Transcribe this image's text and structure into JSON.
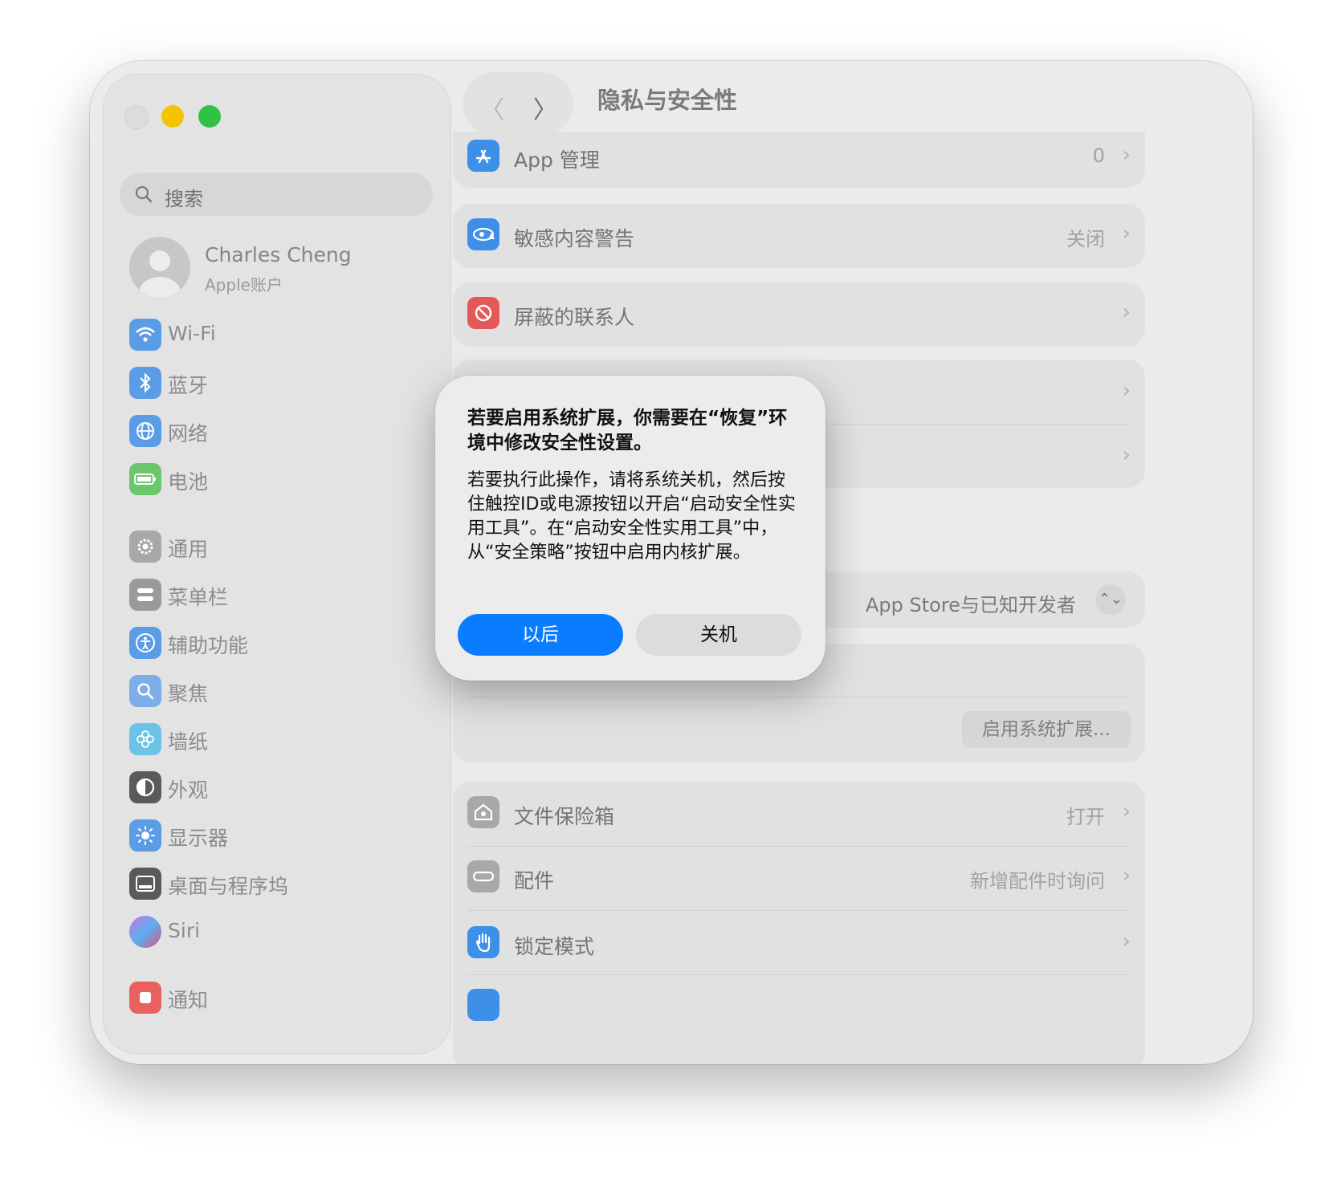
{
  "window": {
    "page_title": "隐私与安全性"
  },
  "sidebar": {
    "search_placeholder": "搜索",
    "profile": {
      "name": "Charles Cheng",
      "subtitle": "Apple账户"
    },
    "items": [
      {
        "label": "Wi-Fi",
        "icon": "wifi-icon",
        "color": "#4a90e2"
      },
      {
        "label": "蓝牙",
        "icon": "bluetooth-icon",
        "color": "#4a90e2"
      },
      {
        "label": "网络",
        "icon": "globe-icon",
        "color": "#4a90e2"
      },
      {
        "label": "电池",
        "icon": "battery-icon",
        "color": "#5ac05a"
      },
      {
        "label": "通用",
        "icon": "gear-icon",
        "color": "#9a9a9a"
      },
      {
        "label": "菜单栏",
        "icon": "menubar-icon",
        "color": "#8a8a8a"
      },
      {
        "label": "辅助功能",
        "icon": "accessibility-icon",
        "color": "#4a90e2"
      },
      {
        "label": "聚焦",
        "icon": "magnifier-icon",
        "color": "#6a9fe2"
      },
      {
        "label": "墙纸",
        "icon": "flower-icon",
        "color": "#5bb7e0"
      },
      {
        "label": "外观",
        "icon": "appearance-icon",
        "color": "#4a4a4a"
      },
      {
        "label": "显示器",
        "icon": "sun-icon",
        "color": "#4a90e2"
      },
      {
        "label": "桌面与程序坞",
        "icon": "dock-icon",
        "color": "#4a4a4a"
      },
      {
        "label": "Siri",
        "icon": "siri-icon",
        "color": "#b565d8"
      },
      {
        "label": "通知",
        "icon": "bell-icon",
        "color": "#e05050"
      }
    ]
  },
  "main": {
    "rows": {
      "app_management": {
        "label": "App 管理",
        "value": "0"
      },
      "sensitive_content": {
        "label": "敏感内容警告",
        "value": "关闭"
      },
      "blocked_contacts": {
        "label": "屏蔽的联系人"
      },
      "allow_apps_value": "App Store与已知开发者",
      "enable_extensions_button": "启用系统扩展...",
      "filevault": {
        "label": "文件保险箱",
        "value": "打开"
      },
      "accessories": {
        "label": "配件",
        "value": "新增配件时询问"
      },
      "lockdown": {
        "label": "锁定模式"
      }
    }
  },
  "dialog": {
    "title": "若要启用系统扩展，你需要在“恢复”环境中修改安全性设置。",
    "body": "若要执行此操作，请将系统关机，然后按住触控ID或电源按钮以开启“启动安全性实用工具”。在“启动安全性实用工具”中，从“安全策略”按钮中启用内核扩展。",
    "later_button": "以后",
    "shutdown_button": "关机"
  },
  "colors": {
    "accent_blue": "#0a7cff",
    "traffic_min": "#f5c400",
    "traffic_max": "#2fc244"
  }
}
